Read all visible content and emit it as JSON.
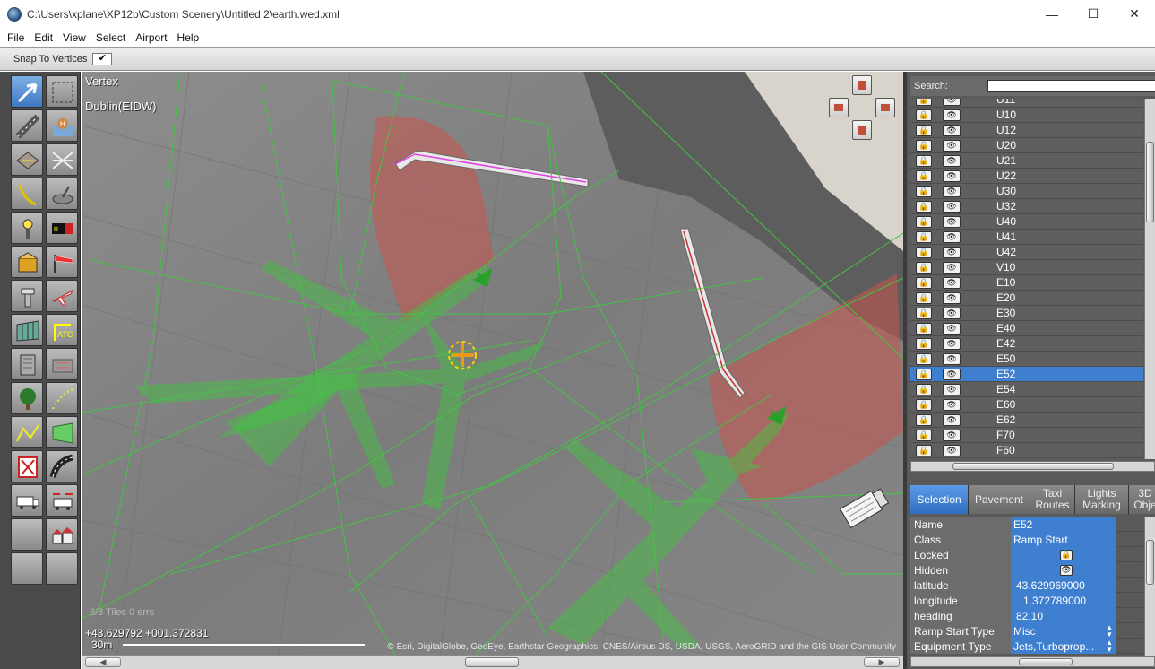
{
  "window": {
    "title": "C:\\Users\\xplane\\XP12b\\Custom Scenery\\Untitled 2\\earth.wed.xml",
    "minimize_glyph": "—",
    "maximize_glyph": "☐",
    "close_glyph": "✕"
  },
  "menu": [
    "File",
    "Edit",
    "View",
    "Select",
    "Airport",
    "Help"
  ],
  "options": {
    "snap_label": "Snap To Vertices",
    "snap_checked_glyph": "✔"
  },
  "map": {
    "tool_name": "Vertex",
    "airport": "Dublin(EIDW)",
    "tiles": "8/8 Tiles 0 errs",
    "coords": "+43.629792 +001.372831",
    "scale": "30m",
    "attribution": "© Esri, DigitalGlobe, GeoEye, Earthstar Geographics, CNES/Airbus DS, USDA, USGS, AeroGRID and the GIS User Community"
  },
  "scroll": {
    "left_glyph": "◀",
    "right_glyph": "▶"
  },
  "search": {
    "label": "Search:",
    "value": ""
  },
  "list": {
    "lock_glyph": "🔒",
    "eye_glyph": "👁",
    "items": [
      "U11",
      "U10",
      "U12",
      "U20",
      "U21",
      "U22",
      "U30",
      "U32",
      "U40",
      "U41",
      "U42",
      "V10",
      "E10",
      "E20",
      "E30",
      "E40",
      "E42",
      "E50",
      "E52",
      "E54",
      "E60",
      "E62",
      "F70",
      "F60"
    ],
    "selected": "E52"
  },
  "tabs": [
    {
      "label": "Selection",
      "active": true
    },
    {
      "label": "Pavement",
      "active": false
    },
    {
      "label": "Taxi Routes",
      "active": false
    },
    {
      "label": "Lights Marking",
      "active": false
    },
    {
      "label": "3D Obje",
      "active": false
    }
  ],
  "properties": {
    "name": {
      "key": "Name",
      "value": "E52"
    },
    "class": {
      "key": "Class",
      "value": "Ramp Start"
    },
    "locked": {
      "key": "Locked"
    },
    "hidden": {
      "key": "Hidden"
    },
    "latitude": {
      "key": "latitude",
      "value": "43.629969000"
    },
    "longitude": {
      "key": "longitude",
      "value": "1.372789000"
    },
    "heading": {
      "key": "heading",
      "value": "82.10"
    },
    "ramp_type": {
      "key": "Ramp Start Type",
      "value": "Misc"
    },
    "equipment": {
      "key": "Equipment Type",
      "value": "Jets,Turboprop..."
    }
  },
  "colors": {
    "selection": "#3f7fd0",
    "panel": "#5a5a5a",
    "aircraft": "#3ec83e",
    "jetway_zone": "#d04b4b"
  }
}
